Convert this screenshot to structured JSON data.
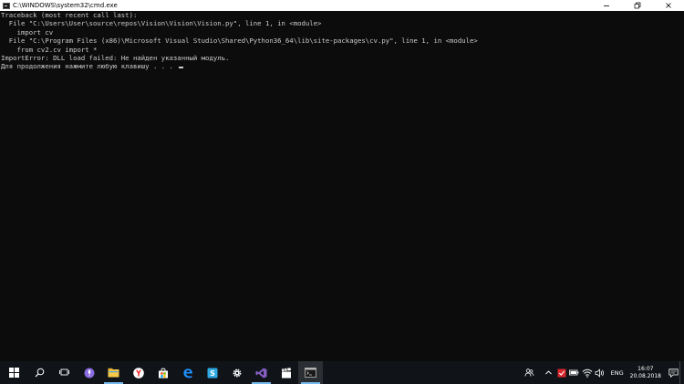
{
  "window": {
    "title": "C:\\WINDOWS\\system32\\cmd.exe",
    "controls": {
      "minimize_icon": "minimize-icon",
      "maximize_icon": "maximize-icon",
      "close_icon": "close-icon"
    }
  },
  "console": {
    "lines": [
      "Traceback (most recent call last):",
      "  File \"C:\\Users\\User\\source\\repos\\Vision\\Vision\\Vision.py\", line 1, in <module>",
      "    import cv",
      "  File \"C:\\Program Files (x86)\\Microsoft Visual Studio\\Shared\\Python36_64\\lib\\site-packages\\cv.py\", line 1, in <module>",
      "    from cv2.cv import *",
      "ImportError: DLL load failed: Не найден указанный модуль.",
      "Для продолжения нажмите любую клавишу . . . "
    ],
    "text_color": "#cccccc",
    "background_color": "#0c0c0c"
  },
  "taskbar": {
    "items": [
      {
        "name": "start-button",
        "icon": "windows-logo-icon"
      },
      {
        "name": "search-button",
        "icon": "search-icon"
      },
      {
        "name": "task-view-button",
        "icon": "task-view-icon"
      },
      {
        "name": "cortana-button",
        "icon": "microphone-icon"
      },
      {
        "name": "file-explorer-button",
        "icon": "folder-icon"
      },
      {
        "name": "yandex-browser-button",
        "icon": "yandex-icon"
      },
      {
        "name": "store-button",
        "icon": "store-icon"
      },
      {
        "name": "edge-button",
        "icon": "edge-icon"
      },
      {
        "name": "skype-button",
        "icon": "skype-icon"
      },
      {
        "name": "settings-button",
        "icon": "gear-icon"
      },
      {
        "name": "visual-studio-button",
        "icon": "visual-studio-icon"
      },
      {
        "name": "movies-button",
        "icon": "clapperboard-icon"
      },
      {
        "name": "cmd-button",
        "icon": "console-icon"
      }
    ],
    "tray": {
      "language": "ENG",
      "time": "16:07",
      "date": "20.08.2018"
    },
    "accent_color": "#76b9ed"
  }
}
